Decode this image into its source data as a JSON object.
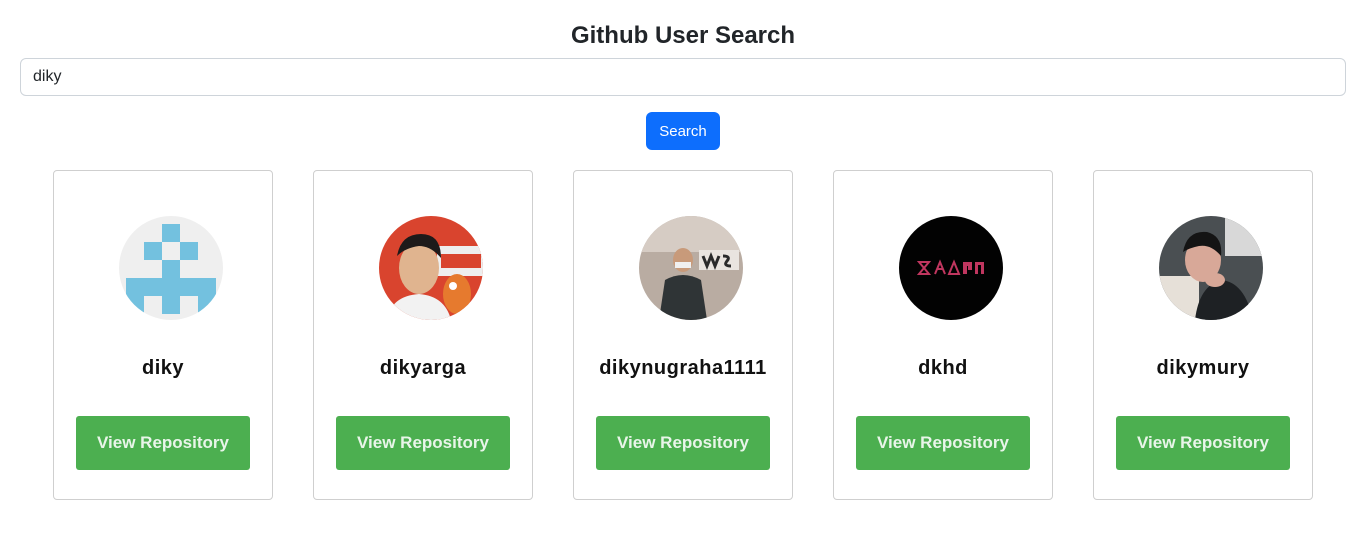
{
  "header": {
    "title": "Github User Search"
  },
  "search": {
    "value": "diky",
    "button_label": "Search"
  },
  "colors": {
    "primary": "#0d6efd",
    "repo_button": "#4caf50",
    "card_border": "#cfcfcf"
  },
  "users": [
    {
      "login": "diky",
      "avatar_icon": "identicon-avatar",
      "button_label": "View Repository"
    },
    {
      "login": "dikyarga",
      "avatar_icon": "photo-avatar",
      "button_label": "View Repository"
    },
    {
      "login": "dikynugraha1111",
      "avatar_icon": "photo-avatar",
      "button_label": "View Repository"
    },
    {
      "login": "dkhd",
      "avatar_icon": "logo-avatar",
      "button_label": "View Repository"
    },
    {
      "login": "dikymury",
      "avatar_icon": "photo-avatar",
      "button_label": "View Repository"
    }
  ]
}
